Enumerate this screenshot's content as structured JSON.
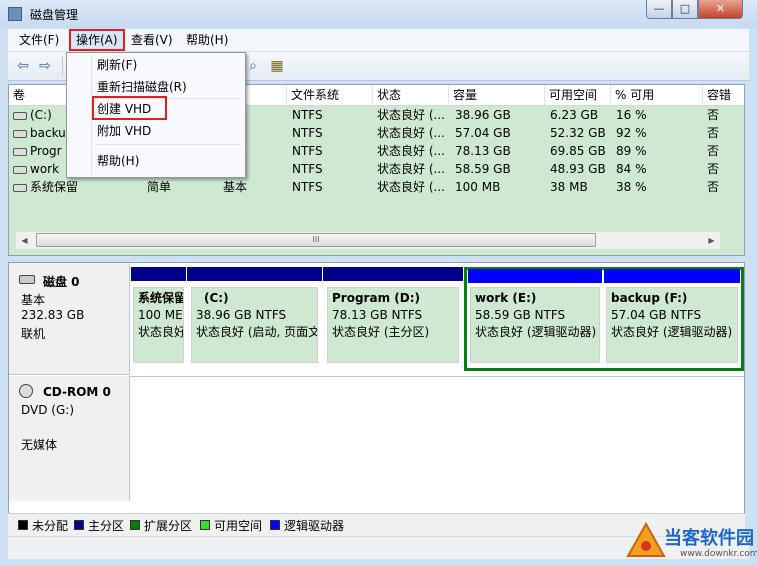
{
  "window": {
    "title": "磁盘管理",
    "min": "—",
    "max": "□",
    "close": "✕"
  },
  "menubar": {
    "file": "文件(F)",
    "action": "操作(A)",
    "view": "查看(V)",
    "help": "帮助(H)"
  },
  "context_menu": {
    "refresh": "刷新(F)",
    "rescan": "重新扫描磁盘(R)",
    "create_vhd": "创建 VHD",
    "attach_vhd": "附加 VHD",
    "help": "帮助(H)"
  },
  "columns": {
    "volume": "卷",
    "fs": "文件系统",
    "status": "状态",
    "capacity": "容量",
    "free": "可用空间",
    "pct": "% 可用",
    "fault": "容错"
  },
  "volumes": [
    {
      "name": "(C:)",
      "layout": "",
      "type": "",
      "fs": "NTFS",
      "status": "状态良好 (...",
      "capacity": "38.96 GB",
      "free": "6.23 GB",
      "pct": "16 %",
      "fault": "否"
    },
    {
      "name": "backup",
      "layout": "",
      "type": "",
      "fs": "NTFS",
      "status": "状态良好 (...",
      "capacity": "57.04 GB",
      "free": "52.32 GB",
      "pct": "92 %",
      "fault": "否"
    },
    {
      "name": "Progr",
      "layout": "",
      "type": "",
      "fs": "NTFS",
      "status": "状态良好 (...",
      "capacity": "78.13 GB",
      "free": "69.85 GB",
      "pct": "89 %",
      "fault": "否"
    },
    {
      "name": "work",
      "layout": "",
      "type": "",
      "fs": "NTFS",
      "status": "状态良好 (...",
      "capacity": "58.59 GB",
      "free": "48.93 GB",
      "pct": "84 %",
      "fault": "否"
    },
    {
      "name": "系统保留",
      "layout": "简单",
      "type": "基本",
      "fs": "NTFS",
      "status": "状态良好 (...",
      "capacity": "100 MB",
      "free": "38 MB",
      "pct": "38 %",
      "fault": "否"
    }
  ],
  "scroll_mid": "III",
  "disk0": {
    "name": "磁盘 0",
    "type": "基本",
    "size": "232.83 GB",
    "state": "联机",
    "partitions": [
      {
        "title": "系统保留",
        "size": "100 ME",
        "status": "状态良好",
        "color": "#00008b"
      },
      {
        "title": "(C:)",
        "size": "38.96 GB NTFS",
        "status": "状态良好 (启动, 页面文",
        "color": "#00008b"
      },
      {
        "title": "Program  (D:)",
        "size": "78.13 GB NTFS",
        "status": "状态良好 (主分区)",
        "color": "#00008b"
      },
      {
        "title": "work  (E:)",
        "size": "58.59 GB NTFS",
        "status": "状态良好 (逻辑驱动器)",
        "color": "#0000ff"
      },
      {
        "title": "backup  (F:)",
        "size": "57.04 GB NTFS",
        "status": "状态良好 (逻辑驱动器)",
        "color": "#0000ff"
      }
    ]
  },
  "cdrom0": {
    "name": "CD-ROM 0",
    "drive": "DVD (G:)",
    "media": "无媒体"
  },
  "legend": [
    {
      "label": "未分配",
      "color": "#000000"
    },
    {
      "label": "主分区",
      "color": "#00008b"
    },
    {
      "label": "扩展分区",
      "color": "#008000"
    },
    {
      "label": "可用空间",
      "color": "#33dd33"
    },
    {
      "label": "逻辑驱动器",
      "color": "#0000ff"
    }
  ],
  "watermark": {
    "brand": "当客软件园",
    "url": "www.downkr.com"
  }
}
